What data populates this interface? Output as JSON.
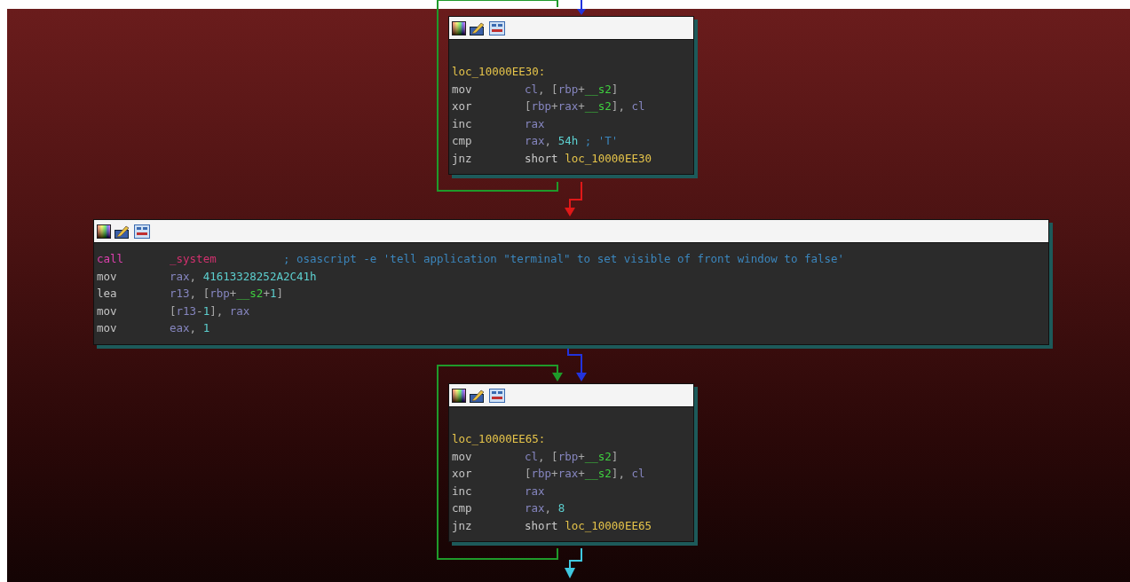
{
  "blocks": [
    {
      "label": "loc_10000EE30:",
      "lines": [
        {
          "mnemonic": "mov",
          "kind": "plain",
          "operand": [
            {
              "t": "cl",
              "kind": "reg"
            },
            {
              "t": ", [",
              "kind": "punct"
            },
            {
              "t": "rbp",
              "kind": "reg"
            },
            {
              "t": "+",
              "kind": "punct"
            },
            {
              "t": "__s2",
              "kind": "var"
            },
            {
              "t": "]",
              "kind": "punct"
            }
          ]
        },
        {
          "mnemonic": "xor",
          "kind": "plain",
          "operand": [
            {
              "t": "[",
              "kind": "punct"
            },
            {
              "t": "rbp",
              "kind": "reg"
            },
            {
              "t": "+",
              "kind": "punct"
            },
            {
              "t": "rax",
              "kind": "reg"
            },
            {
              "t": "+",
              "kind": "punct"
            },
            {
              "t": "__s2",
              "kind": "var"
            },
            {
              "t": "], ",
              "kind": "punct"
            },
            {
              "t": "cl",
              "kind": "reg"
            }
          ]
        },
        {
          "mnemonic": "inc",
          "kind": "plain",
          "operand": [
            {
              "t": "rax",
              "kind": "reg"
            }
          ]
        },
        {
          "mnemonic": "cmp",
          "kind": "plain",
          "operand": [
            {
              "t": "rax",
              "kind": "reg"
            },
            {
              "t": ", ",
              "kind": "punct"
            },
            {
              "t": "54h",
              "kind": "num"
            },
            {
              "t": " ; 'T'",
              "kind": "comment"
            }
          ]
        },
        {
          "mnemonic": "jnz",
          "kind": "plain",
          "operand": [
            {
              "t": "short ",
              "kind": "keyword"
            },
            {
              "t": "loc_10000EE30",
              "kind": "label"
            }
          ]
        }
      ]
    },
    {
      "lines": [
        {
          "mnemonic": "call",
          "kind": "call",
          "operand": [
            {
              "t": "_system",
              "kind": "func"
            },
            {
              "t": "          ; osascript -e 'tell application \"terminal\" to set visible of front window to false'",
              "kind": "comment"
            }
          ]
        },
        {
          "mnemonic": "mov",
          "kind": "plain",
          "operand": [
            {
              "t": "rax",
              "kind": "reg"
            },
            {
              "t": ", ",
              "kind": "punct"
            },
            {
              "t": "41613328252A2C41h",
              "kind": "num"
            }
          ]
        },
        {
          "mnemonic": "lea",
          "kind": "plain",
          "operand": [
            {
              "t": "r13",
              "kind": "reg"
            },
            {
              "t": ", [",
              "kind": "punct"
            },
            {
              "t": "rbp",
              "kind": "reg"
            },
            {
              "t": "+",
              "kind": "punct"
            },
            {
              "t": "__s2",
              "kind": "var"
            },
            {
              "t": "+",
              "kind": "punct"
            },
            {
              "t": "1",
              "kind": "num"
            },
            {
              "t": "]",
              "kind": "punct"
            }
          ]
        },
        {
          "mnemonic": "mov",
          "kind": "plain",
          "operand": [
            {
              "t": "[",
              "kind": "punct"
            },
            {
              "t": "r13",
              "kind": "reg"
            },
            {
              "t": "-",
              "kind": "punct"
            },
            {
              "t": "1",
              "kind": "num"
            },
            {
              "t": "], ",
              "kind": "punct"
            },
            {
              "t": "rax",
              "kind": "reg"
            }
          ]
        },
        {
          "mnemonic": "mov",
          "kind": "plain",
          "operand": [
            {
              "t": "eax",
              "kind": "reg"
            },
            {
              "t": ", ",
              "kind": "punct"
            },
            {
              "t": "1",
              "kind": "num"
            }
          ]
        }
      ]
    },
    {
      "label": "loc_10000EE65:",
      "lines": [
        {
          "mnemonic": "mov",
          "kind": "plain",
          "operand": [
            {
              "t": "cl",
              "kind": "reg"
            },
            {
              "t": ", [",
              "kind": "punct"
            },
            {
              "t": "rbp",
              "kind": "reg"
            },
            {
              "t": "+",
              "kind": "punct"
            },
            {
              "t": "__s2",
              "kind": "var"
            },
            {
              "t": "]",
              "kind": "punct"
            }
          ]
        },
        {
          "mnemonic": "xor",
          "kind": "plain",
          "operand": [
            {
              "t": "[",
              "kind": "punct"
            },
            {
              "t": "rbp",
              "kind": "reg"
            },
            {
              "t": "+",
              "kind": "punct"
            },
            {
              "t": "rax",
              "kind": "reg"
            },
            {
              "t": "+",
              "kind": "punct"
            },
            {
              "t": "__s2",
              "kind": "var"
            },
            {
              "t": "], ",
              "kind": "punct"
            },
            {
              "t": "cl",
              "kind": "reg"
            }
          ]
        },
        {
          "mnemonic": "inc",
          "kind": "plain",
          "operand": [
            {
              "t": "rax",
              "kind": "reg"
            }
          ]
        },
        {
          "mnemonic": "cmp",
          "kind": "plain",
          "operand": [
            {
              "t": "rax",
              "kind": "reg"
            },
            {
              "t": ", ",
              "kind": "punct"
            },
            {
              "t": "8",
              "kind": "num"
            }
          ]
        },
        {
          "mnemonic": "jnz",
          "kind": "plain",
          "operand": [
            {
              "t": "short ",
              "kind": "keyword"
            },
            {
              "t": "loc_10000EE65",
              "kind": "label"
            }
          ]
        }
      ]
    }
  ]
}
